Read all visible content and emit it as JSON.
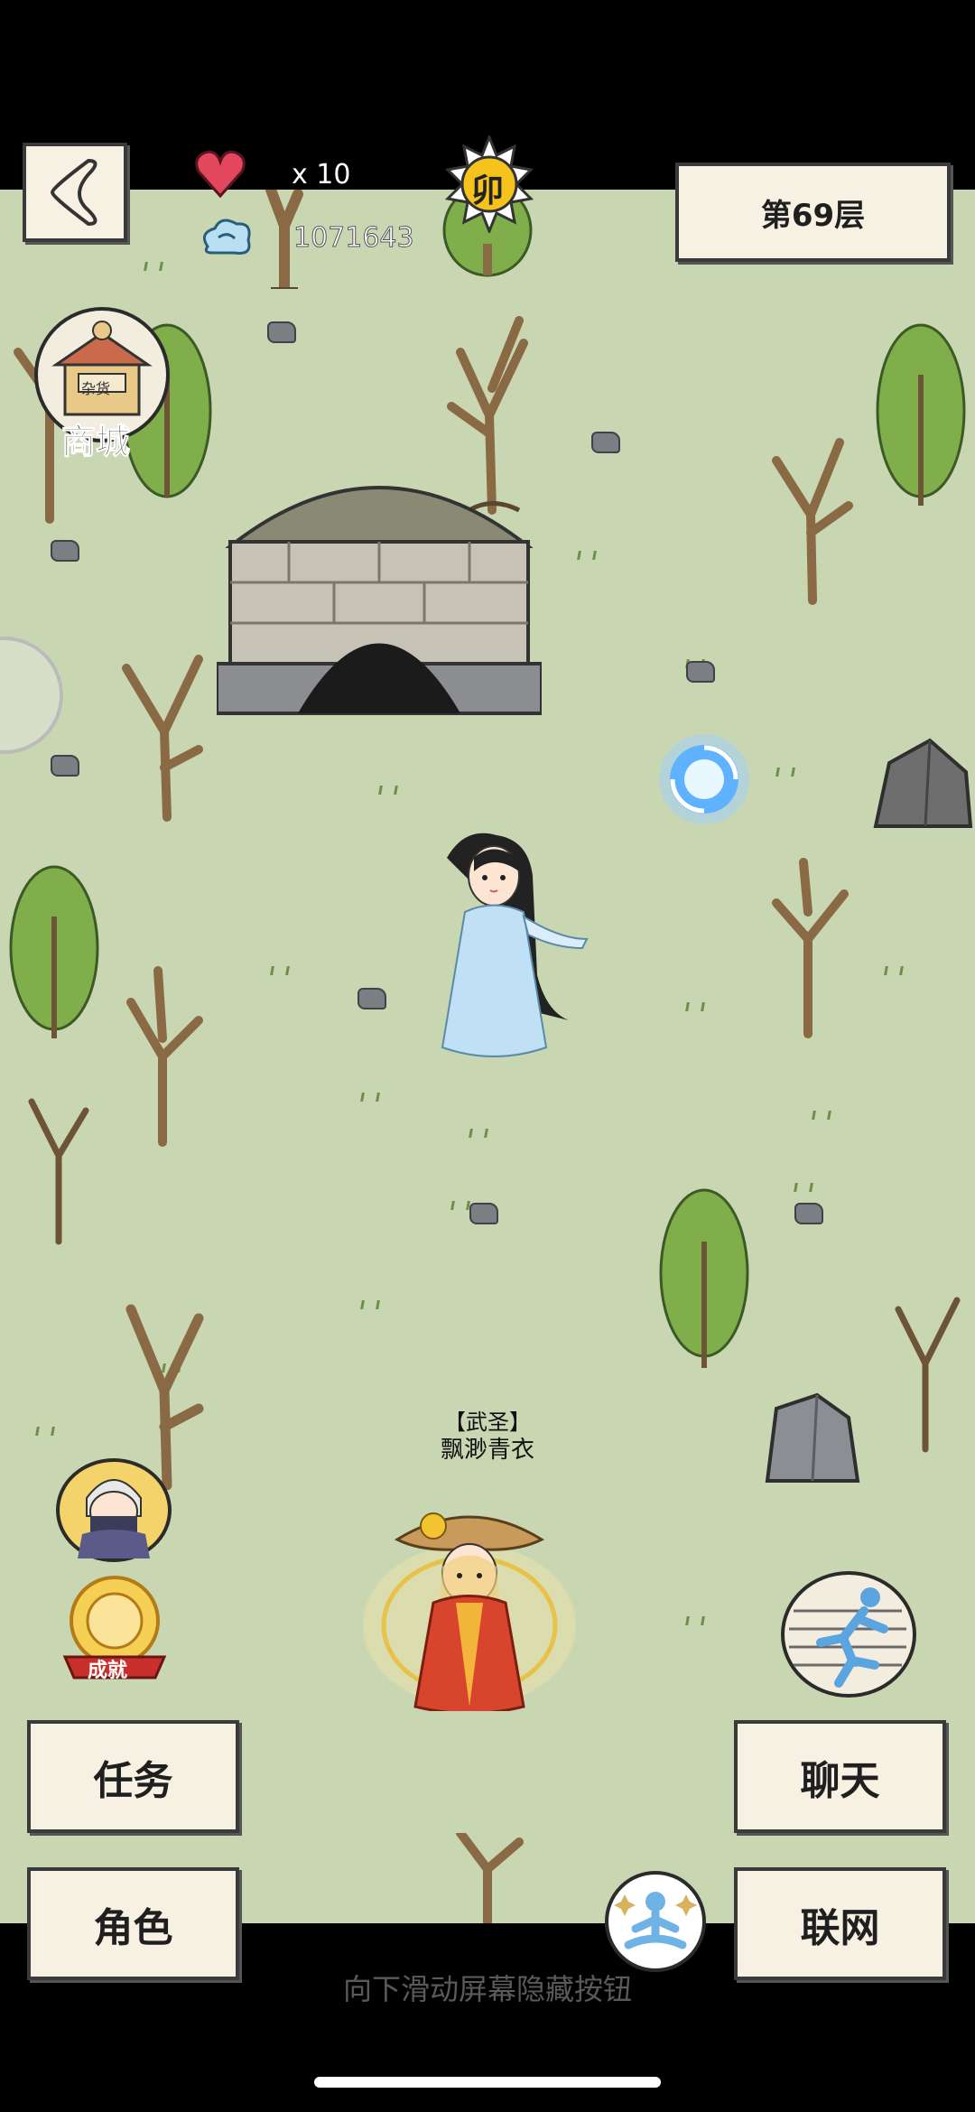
{
  "hud": {
    "lives": "x 10",
    "currency": "1071643",
    "floor_label": "第69层",
    "time_glyph": "卯"
  },
  "map": {
    "shop_label": "商城",
    "shop_sign": "杂货",
    "player_title": "【武圣】",
    "player_name": "飘渺青衣",
    "achievement_label": "成就"
  },
  "buttons": {
    "quest": "任务",
    "character": "角色",
    "chat": "聊天",
    "network": "联网"
  },
  "footer": {
    "hint": "向下滑动屏幕隐藏按钮"
  },
  "colors": {
    "ground": "#c9d6b2",
    "button_bg": "#f6f1e2",
    "tree_green": "#7fae4a",
    "trunk": "#8a6a44"
  },
  "icons": [
    "back-arrow-icon",
    "heart-icon",
    "spirit-cloud-icon",
    "sun-time-icon",
    "shop-icon",
    "cave-entrance",
    "portal-icon",
    "npc-girl",
    "ninja-avatar-icon",
    "achievement-icon",
    "run-icon",
    "meditate-icon",
    "player-character"
  ]
}
